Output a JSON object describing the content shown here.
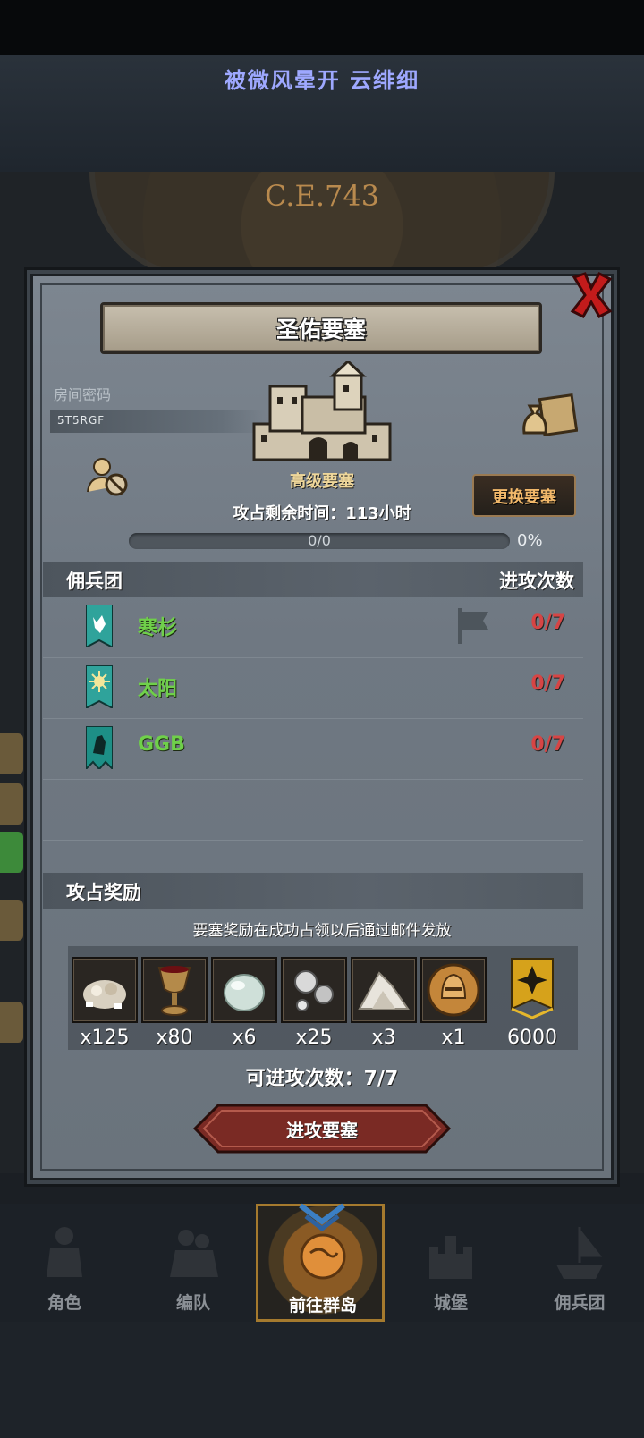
{
  "status_banner": {
    "title": "被微风晕开 云绯细"
  },
  "map": {
    "year": "C.E.743"
  },
  "dialog": {
    "title": "圣佑要塞",
    "room_label": "房间密码",
    "room_code": "5T5RGF",
    "fortress_grade": "高级要塞",
    "change_button": "更换要塞",
    "time_remaining": "攻占剩余时间：113小时",
    "progress": {
      "text": "0/0",
      "percent_label": "0%",
      "fraction": 0
    },
    "mercenary_section": {
      "title": "佣兵团",
      "count_header": "进攻次数"
    },
    "mercenaries": [
      {
        "name": "寒杉",
        "count": "0/7",
        "banner_color": "#2fa39b"
      },
      {
        "name": "太阳",
        "count": "0/7",
        "banner_color": "#2fa39b"
      },
      {
        "name": "GGB",
        "count": "0/7",
        "banner_color": "#1d8f86"
      }
    ],
    "reward_section": {
      "title": "攻占奖励",
      "note": "要塞奖励在成功占领以后通过邮件发放",
      "items": [
        {
          "icon": "ore-pile-icon",
          "qty": "x125"
        },
        {
          "icon": "goblet-icon",
          "qty": "x80"
        },
        {
          "icon": "moonstone-icon",
          "qty": "x6"
        },
        {
          "icon": "silver-pearls-icon",
          "qty": "x25"
        },
        {
          "icon": "salt-pile-icon",
          "qty": "x3"
        },
        {
          "icon": "helmet-coin-icon",
          "qty": "x1"
        },
        {
          "icon": "honor-medal-icon",
          "qty": "6000"
        }
      ]
    },
    "attack_remaining": "可进攻次数：7/7",
    "attack_button": "进攻要塞"
  },
  "bottom_nav": [
    {
      "label": "角色",
      "icon": "knight-icon"
    },
    {
      "label": "编队",
      "icon": "team-icon"
    },
    {
      "label": "前往群岛",
      "icon": "compass-globe-icon",
      "active": true
    },
    {
      "label": "城堡",
      "icon": "castle-icon"
    },
    {
      "label": "佣兵团",
      "icon": "ship-icon"
    }
  ],
  "colors": {
    "accent_gold": "#f2b86a",
    "merc_name_green": "#6fd04a",
    "count_red": "#d64545",
    "panel_grey": "#727b85"
  }
}
